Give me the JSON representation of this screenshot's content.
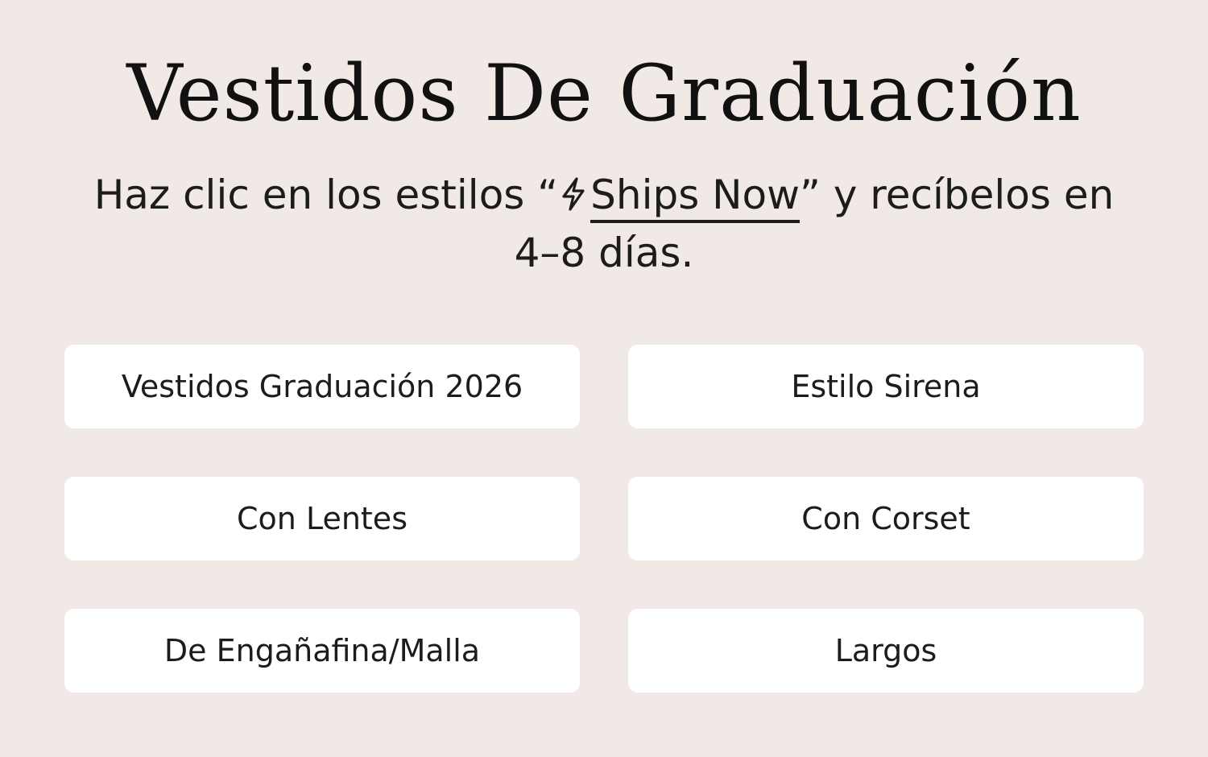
{
  "heading": {
    "title": "Vestidos De Graduación"
  },
  "subtitle": {
    "before": "Haz clic en los estilos “",
    "icon": "lightning-bolt-icon",
    "link_text": "Ships Now",
    "after_link": "” y recíbelos en",
    "line2": "4–8 días."
  },
  "categories": [
    {
      "label": "Vestidos Graduación 2026"
    },
    {
      "label": "Estilo Sirena"
    },
    {
      "label": "Con Lentes"
    },
    {
      "label": "Con Corset"
    },
    {
      "label": "De Engañafina/Malla"
    },
    {
      "label": "Largos"
    }
  ],
  "colors": {
    "background": "#f1e9e6",
    "card": "#ffffff",
    "text": "#171717"
  }
}
